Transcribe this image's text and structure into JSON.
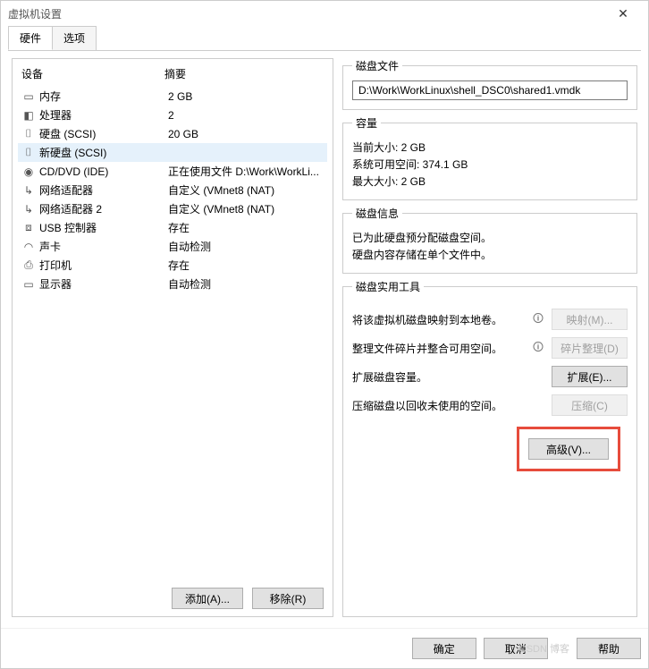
{
  "window": {
    "title": "虚拟机设置"
  },
  "tabs": {
    "hardware": "硬件",
    "options": "选项"
  },
  "headers": {
    "device": "设备",
    "summary": "摘要"
  },
  "devices": [
    {
      "icon": "▭",
      "name": "内存",
      "summary": "2 GB"
    },
    {
      "icon": "◧",
      "name": "处理器",
      "summary": "2"
    },
    {
      "icon": "⌷",
      "name": "硬盘 (SCSI)",
      "summary": "20 GB"
    },
    {
      "icon": "⌷",
      "name": "新硬盘 (SCSI)",
      "summary": ""
    },
    {
      "icon": "◉",
      "name": "CD/DVD (IDE)",
      "summary": "正在使用文件 D:\\Work\\WorkLi..."
    },
    {
      "icon": "↳",
      "name": "网络适配器",
      "summary": "自定义 (VMnet8 (NAT)"
    },
    {
      "icon": "↳",
      "name": "网络适配器 2",
      "summary": "自定义 (VMnet8 (NAT)"
    },
    {
      "icon": "⧈",
      "name": "USB 控制器",
      "summary": "存在"
    },
    {
      "icon": "◠",
      "name": "声卡",
      "summary": "自动检测"
    },
    {
      "icon": "⎙",
      "name": "打印机",
      "summary": "存在"
    },
    {
      "icon": "▭",
      "name": "显示器",
      "summary": "自动检测"
    }
  ],
  "selectedDeviceIndex": 3,
  "leftButtons": {
    "add": "添加(A)...",
    "remove": "移除(R)"
  },
  "right": {
    "diskFile": {
      "legend": "磁盘文件",
      "path": "D:\\Work\\WorkLinux\\shell_DSC0\\shared1.vmdk"
    },
    "capacity": {
      "legend": "容量",
      "currentSize": "当前大小: 2 GB",
      "freeSpace": "系统可用空间: 374.1 GB",
      "maxSize": "最大大小: 2 GB"
    },
    "diskInfo": {
      "legend": "磁盘信息",
      "line1": "已为此硬盘预分配磁盘空间。",
      "line2": "硬盘内容存储在单个文件中。"
    },
    "tools": {
      "legend": "磁盘实用工具",
      "map": {
        "text": "将该虚拟机磁盘映射到本地卷。",
        "btn": "映射(M)...",
        "enabled": false
      },
      "defrag": {
        "text": "整理文件碎片并整合可用空间。",
        "btn": "碎片整理(D)",
        "enabled": false
      },
      "expand": {
        "text": "扩展磁盘容量。",
        "btn": "扩展(E)...",
        "enabled": true
      },
      "compact": {
        "text": "压缩磁盘以回收未使用的空间。",
        "btn": "压缩(C)",
        "enabled": false
      },
      "advanced": "高级(V)..."
    }
  },
  "footer": {
    "ok": "确定",
    "cancel": "取消",
    "help": "帮助"
  },
  "watermark": "CSDN 博客"
}
